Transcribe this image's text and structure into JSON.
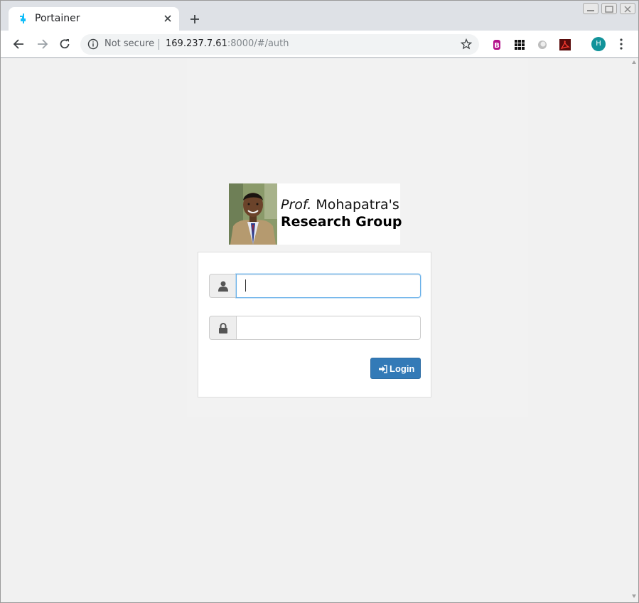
{
  "browser": {
    "tab_title": "Portainer",
    "address": {
      "security_label": "Not secure",
      "host": "169.237.7.61",
      "path": ":8000/#/auth"
    },
    "profile_initial": "H"
  },
  "logo": {
    "line1_prefix": "Prof.",
    "line1_rest": " Mohapatra's",
    "line2": "Research Group"
  },
  "login": {
    "username_value": "",
    "password_value": "",
    "button_label": "Login"
  },
  "colors": {
    "button": "#337ab7",
    "focus": "#66afe9",
    "page_bg": "#f1f1f1"
  }
}
